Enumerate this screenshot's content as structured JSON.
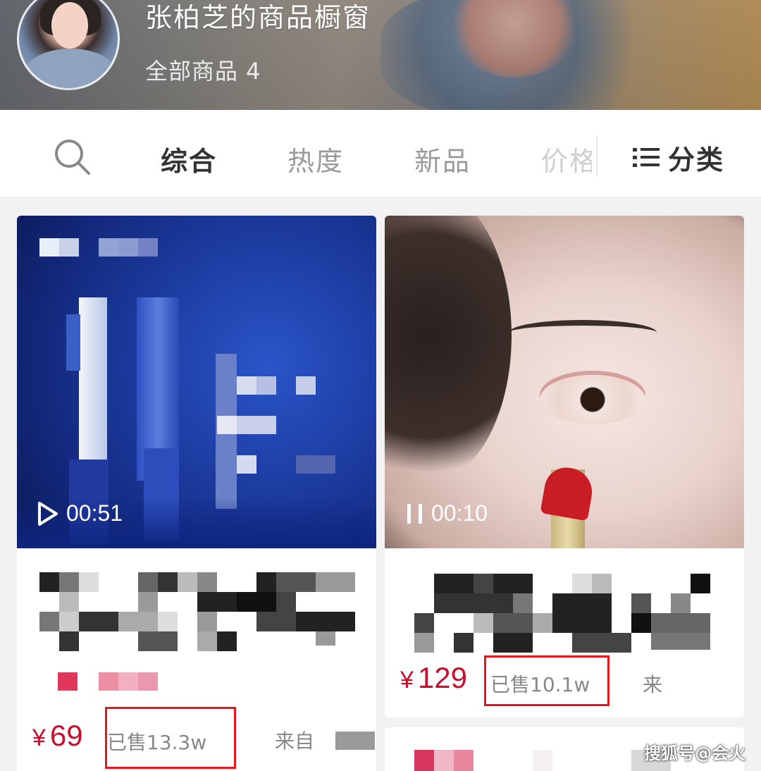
{
  "header": {
    "shop_title": "张柏芝的商品橱窗",
    "product_count_label": "全部商品 4"
  },
  "tabs": {
    "items": [
      "综合",
      "热度",
      "新品",
      "价格"
    ],
    "active": "综合",
    "category_label": "分类",
    "search_icon": "search-icon",
    "category_icon": "list-icon"
  },
  "products": [
    {
      "video_duration": "00:51",
      "video_state": "play",
      "price_symbol": "¥",
      "price": "69",
      "sold": "已售13.3w",
      "from_label": "来自",
      "highlighted": true
    },
    {
      "video_duration": "00:10",
      "video_state": "pause",
      "price_symbol": "¥",
      "price": "129",
      "sold": "已售10.1w",
      "from_label": "来",
      "highlighted": true
    }
  ],
  "watermark": "搜狐号@会火",
  "colors": {
    "price_red": "#c8102e",
    "highlight_red": "#e6161c",
    "active_tab": "#333333",
    "inactive_tab": "#9a9a9a"
  }
}
